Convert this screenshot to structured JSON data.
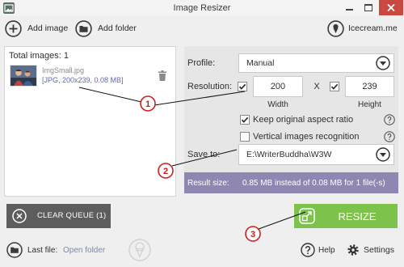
{
  "window": {
    "title": "Image Resizer",
    "app_icon": "image-resizer-app-icon",
    "controls": [
      "minimize-icon",
      "maximize-icon",
      "close-icon"
    ]
  },
  "toolbar": {
    "add_image": {
      "label": "Add image",
      "icon": "add-icon"
    },
    "add_folder": {
      "label": "Add folder",
      "icon": "folder-icon"
    },
    "website": {
      "label": "Icecream.me",
      "icon": "icecream-icon"
    }
  },
  "queue": {
    "total_label": "Total images: 1",
    "items": [
      {
        "name": "ImgSmall.jpg",
        "info": "[JPG, 200x239, 0.08 MB]",
        "icon": "trash-icon"
      }
    ]
  },
  "settings": {
    "profile": {
      "label": "Profile:",
      "value": "Manual"
    },
    "resolution": {
      "label": "Resolution:",
      "width_enabled": true,
      "width": "200",
      "width_label": "Width",
      "separator": "X",
      "height_enabled": true,
      "height": "239",
      "height_label": "Height"
    },
    "keep_aspect_ratio": {
      "label": "Keep original aspect ratio",
      "checked": true
    },
    "vertical_recognition": {
      "label": "Vertical images recognition",
      "checked": false
    },
    "save_to": {
      "label": "Save to:",
      "value": "E:\\WriterBuddha\\W3W"
    },
    "result": {
      "label": "Result size:",
      "value": "0.85 MB instead of 0.08 MB for 1 file(-s)"
    }
  },
  "actions": {
    "clear_queue": "CLEAR QUEUE (1)",
    "resize": "RESIZE"
  },
  "footer": {
    "last_file_label": "Last file:",
    "open_folder": "Open folder",
    "help": "Help",
    "settings": "Settings"
  },
  "annotations": [
    {
      "label": "1"
    },
    {
      "label": "2"
    },
    {
      "label": "3"
    }
  ],
  "colors": {
    "resize_button": "#7dc24b",
    "clear_button": "#5d5d5d",
    "result_bar": "#8f87b2",
    "file_info": "#6266b0",
    "link": "#7b8ca3",
    "annotation": "#d21f1f",
    "close_button": "#c9483f"
  }
}
